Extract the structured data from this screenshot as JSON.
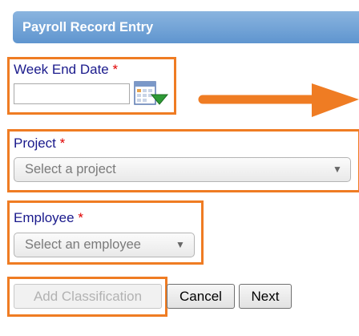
{
  "header": {
    "title": "Payroll Record Entry"
  },
  "week_end_date": {
    "label": "Week End Date",
    "required_marker": "*",
    "value": "",
    "calendar_icon": "calendar-icon"
  },
  "project": {
    "label": "Project",
    "required_marker": "*",
    "placeholder": "Select a project"
  },
  "employee": {
    "label": "Employee",
    "required_marker": "*",
    "placeholder": "Select an employee"
  },
  "buttons": {
    "add_classification": "Add Classification",
    "cancel": "Cancel",
    "next": "Next"
  },
  "annotation": {
    "highlight_color": "#ef7c23",
    "arrow_icon": "right-arrow-icon"
  },
  "colors": {
    "header_start": "#8ab4df",
    "header_end": "#5f95cf",
    "label_color": "#1a1a8c",
    "required_color": "#e00000"
  }
}
